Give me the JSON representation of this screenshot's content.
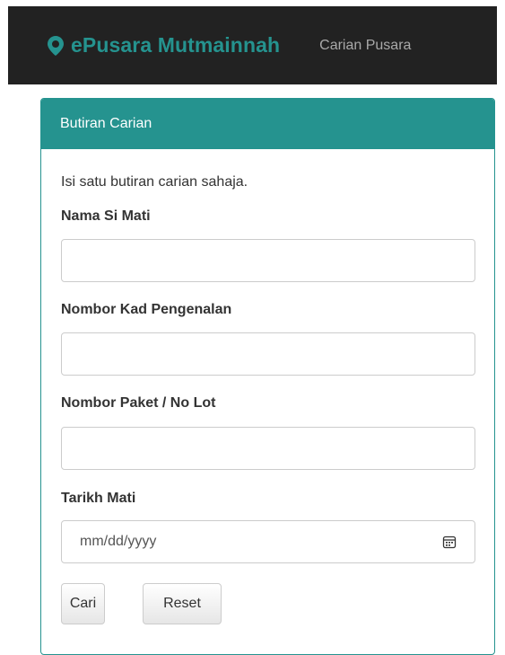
{
  "navbar": {
    "brand": "ePusara Mutmainnah",
    "brand_icon": "map-marker-icon",
    "brand_color": "#25938f",
    "links": [
      {
        "label": "Carian Pusara"
      }
    ]
  },
  "panel": {
    "heading": "Butiran Carian",
    "instruction": "Isi satu butiran carian sahaja.",
    "fields": [
      {
        "label": "Nama Si Mati",
        "value": "",
        "placeholder": ""
      },
      {
        "label": "Nombor Kad Pengenalan",
        "value": "",
        "placeholder": ""
      },
      {
        "label": "Nombor Paket / No Lot",
        "value": "",
        "placeholder": ""
      }
    ],
    "date_field": {
      "label": "Tarikh Mati",
      "placeholder": "mm/dd/yyyy",
      "icon": "calendar-icon"
    },
    "buttons": {
      "search": "Cari",
      "reset": "Reset"
    },
    "accent_color": "#25938f"
  }
}
